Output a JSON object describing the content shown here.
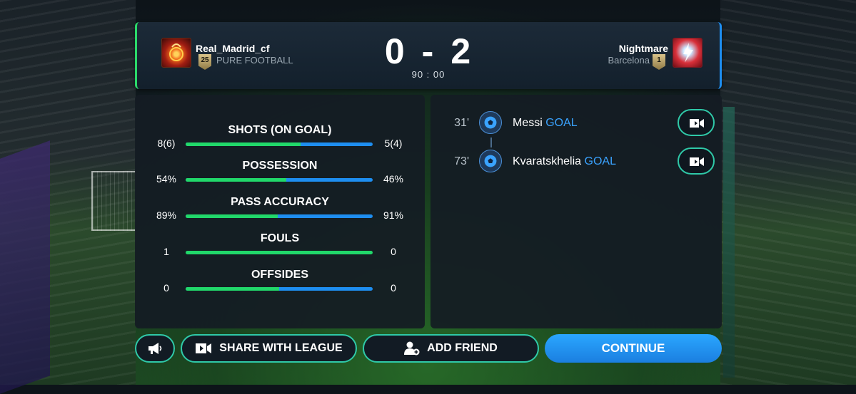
{
  "scoreboard": {
    "home": {
      "name": "Real_Madrid_cf",
      "club": "PURE FOOTBALL",
      "rank": "25",
      "badge_icon": "fire-badge-icon"
    },
    "away": {
      "name": "Nightmare",
      "club": "Barcelona",
      "rank": "1",
      "badge_icon": "lightning-badge-icon"
    },
    "home_score": "0",
    "separator": "-",
    "away_score": "2",
    "time": "90 : 00"
  },
  "stats": [
    {
      "label": "SHOTS (ON GOAL)",
      "home": "8(6)",
      "away": "5(4)",
      "home_share": 0.615
    },
    {
      "label": "POSSESSION",
      "home": "54%",
      "away": "46%",
      "home_share": 0.54
    },
    {
      "label": "PASS ACCURACY",
      "home": "89%",
      "away": "91%",
      "home_share": 0.494
    },
    {
      "label": "FOULS",
      "home": "1",
      "away": "0",
      "home_share": 1.0
    },
    {
      "label": "OFFSIDES",
      "home": "0",
      "away": "0",
      "home_share": 0.5
    }
  ],
  "events": [
    {
      "minute": "31'",
      "player": "Messi",
      "type": "GOAL",
      "icon": "soccer-ball-icon"
    },
    {
      "minute": "73'",
      "player": "Kvaratskhelia",
      "type": "GOAL",
      "icon": "soccer-ball-icon"
    }
  ],
  "buttons": {
    "share": "SHARE WITH LEAGUE",
    "add_friend": "ADD FRIEND",
    "continue": "CONTINUE"
  },
  "colors": {
    "home_bar": "#21d86a",
    "away_bar": "#1e8ef0",
    "button_outline": "#2fc9a8",
    "continue_button": "#1b8cf0",
    "goal_text": "#3aa3ff"
  }
}
